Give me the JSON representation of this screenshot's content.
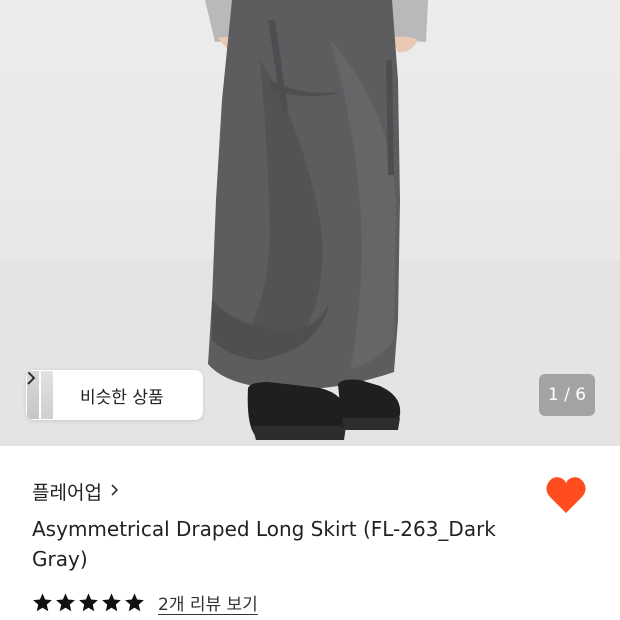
{
  "gallery": {
    "similar_products_label": "비슷한 상품",
    "counter": "1 / 6"
  },
  "product": {
    "brand": "플레어업",
    "title": "Asymmetrical Draped Long Skirt (FL-263_Dark Gray)",
    "rating_stars": 5,
    "review_link": "2개 리뷰 보기"
  },
  "colors": {
    "wishlist_heart": "#ff4d1f",
    "skirt": "#5b5b5e",
    "background": "#ebebeb"
  },
  "icons": [
    "chevron-right-icon",
    "heart-icon",
    "star-icon"
  ]
}
